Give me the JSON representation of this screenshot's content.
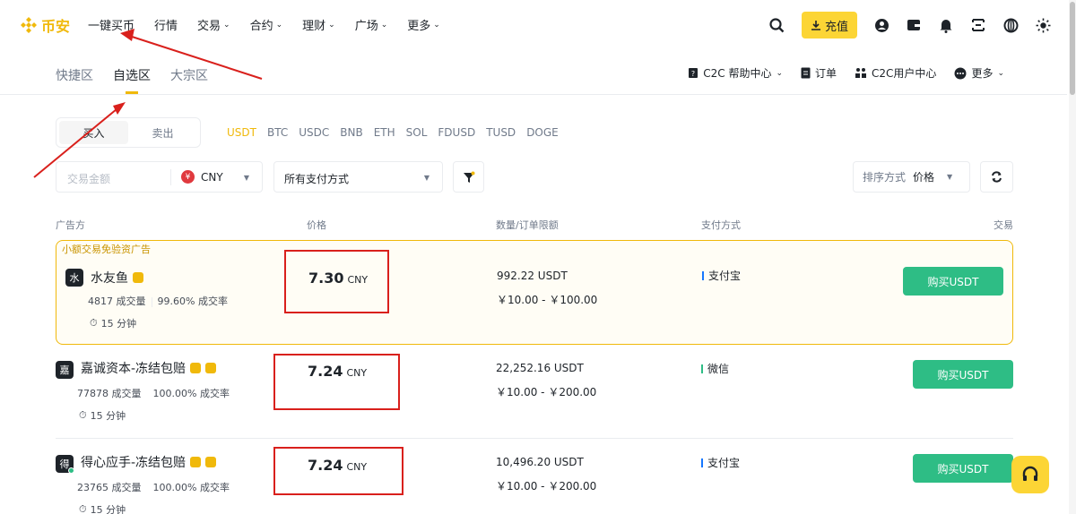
{
  "brand": {
    "name": "币安",
    "accent": "#f0b90b"
  },
  "nav": {
    "items": [
      {
        "label": "一键买币",
        "has_menu": false
      },
      {
        "label": "行情",
        "has_menu": false
      },
      {
        "label": "交易",
        "has_menu": true
      },
      {
        "label": "合约",
        "has_menu": true
      },
      {
        "label": "理财",
        "has_menu": true
      },
      {
        "label": "广场",
        "has_menu": true
      },
      {
        "label": "更多",
        "has_menu": true
      }
    ],
    "deposit_label": "充值"
  },
  "subnav": {
    "tabs": [
      {
        "label": "快捷区",
        "active": false
      },
      {
        "label": "自选区",
        "active": true
      },
      {
        "label": "大宗区",
        "active": false
      }
    ],
    "help_label": "C2C 帮助中心",
    "orders_label": "订单",
    "user_center_label": "C2C用户中心",
    "more_label": "更多"
  },
  "trade_side": {
    "buy": "买入",
    "sell": "卖出",
    "selected": "buy"
  },
  "coins": [
    "USDT",
    "BTC",
    "USDC",
    "BNB",
    "ETH",
    "SOL",
    "FDUSD",
    "TUSD",
    "DOGE"
  ],
  "selected_coin": "USDT",
  "filters": {
    "amount_placeholder": "交易金额",
    "fiat": "CNY",
    "fiat_symbol": "¥",
    "payment": "所有支付方式",
    "sort_label": "排序方式",
    "sort_value": "价格"
  },
  "table": {
    "headers": {
      "advertiser": "广告方",
      "price": "价格",
      "qty": "数量/订单限额",
      "payment": "支付方式",
      "trade": "交易"
    }
  },
  "ads": [
    {
      "promo": "小额交易免验资广告",
      "avatar": "水",
      "name": "水友鱼",
      "orders": "4817 成交量",
      "rate": "99.60% 成交率",
      "time": "15 分钟",
      "price": "7.30",
      "unit": "CNY",
      "qty": "992.22 USDT",
      "limit": "￥10.00 - ￥100.00",
      "payment": "支付宝",
      "payment_color": "#1677ff",
      "button": "购买USDT"
    },
    {
      "promo": "",
      "avatar": "嘉",
      "name": "嘉诚资本-冻结包赔",
      "orders": "77878 成交量",
      "rate": "100.00% 成交率",
      "time": "15 分钟",
      "price": "7.24",
      "unit": "CNY",
      "qty": "22,252.16 USDT",
      "limit": "￥10.00 - ￥200.00",
      "payment": "微信",
      "payment_color": "#2ebd85",
      "button": "购买USDT"
    },
    {
      "promo": "",
      "avatar": "得",
      "name": "得心应手-冻结包赔",
      "orders": "23765 成交量",
      "rate": "100.00% 成交率",
      "time": "15 分钟",
      "price": "7.24",
      "unit": "CNY",
      "qty": "10,496.20 USDT",
      "limit": "￥10.00 - ￥200.00",
      "payment": "支付宝",
      "payment_color": "#1677ff",
      "button": "购买USDT"
    }
  ]
}
